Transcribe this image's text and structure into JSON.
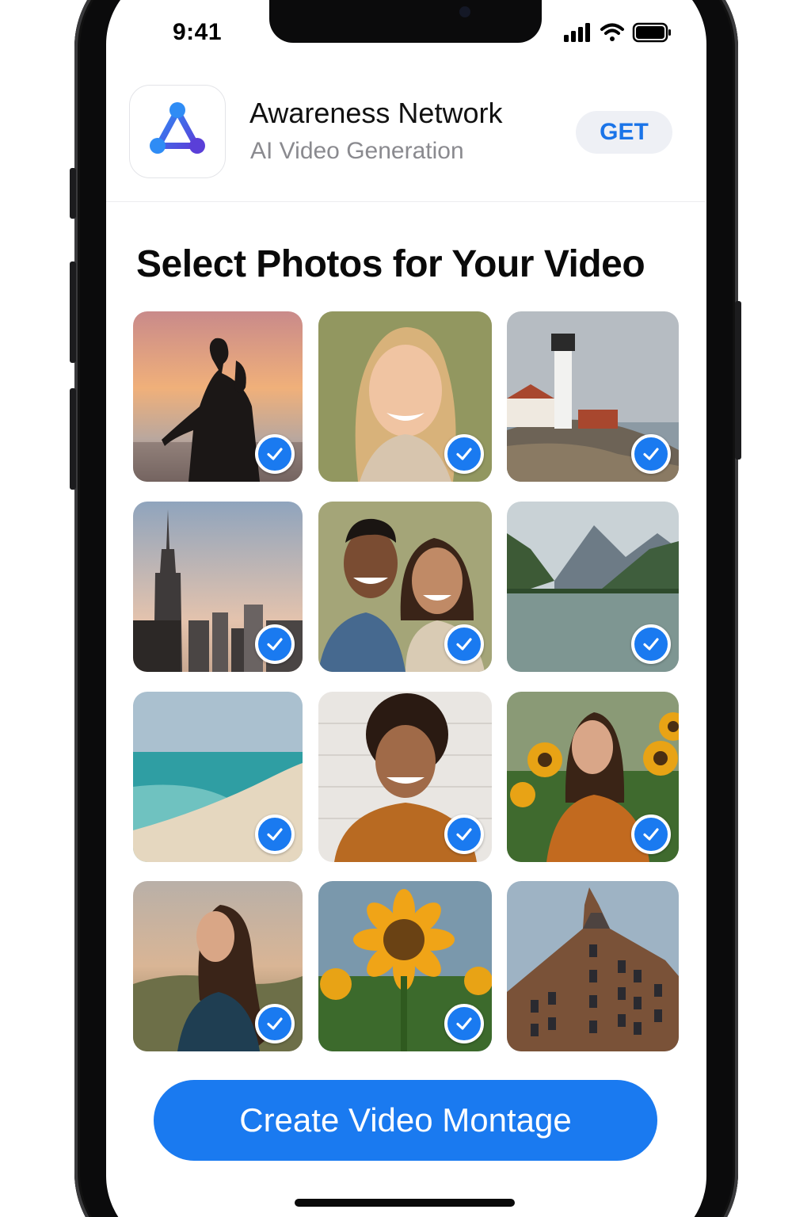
{
  "status_bar": {
    "time": "9:41",
    "icons": [
      "signal-icon",
      "wifi-icon",
      "battery-icon"
    ]
  },
  "app_banner": {
    "icon": "network-triangle-icon",
    "name": "Awareness Network",
    "subtitle": "AI Video Generation",
    "get_label": "GET"
  },
  "section": {
    "title": "Select Photos for Your Video"
  },
  "photos": [
    {
      "subject": "woman running at sunset",
      "selected": true
    },
    {
      "subject": "smiling blonde woman portrait",
      "selected": true
    },
    {
      "subject": "lighthouse on rocky coast",
      "selected": true
    },
    {
      "subject": "city skyline with skyscraper",
      "selected": true
    },
    {
      "subject": "smiling couple",
      "selected": true
    },
    {
      "subject": "mountain lake",
      "selected": true
    },
    {
      "subject": "beach shoreline",
      "selected": true
    },
    {
      "subject": "smiling man with curly hair",
      "selected": true
    },
    {
      "subject": "woman among sunflowers",
      "selected": true
    },
    {
      "subject": "woman in landscape",
      "selected": true
    },
    {
      "subject": "sunflower close-up",
      "selected": true
    },
    {
      "subject": "historic brick building",
      "selected": false
    }
  ],
  "actions": {
    "create_label": "Create Video Montage"
  },
  "colors": {
    "accent": "#1a7af0",
    "get_text": "#1a74e8"
  }
}
